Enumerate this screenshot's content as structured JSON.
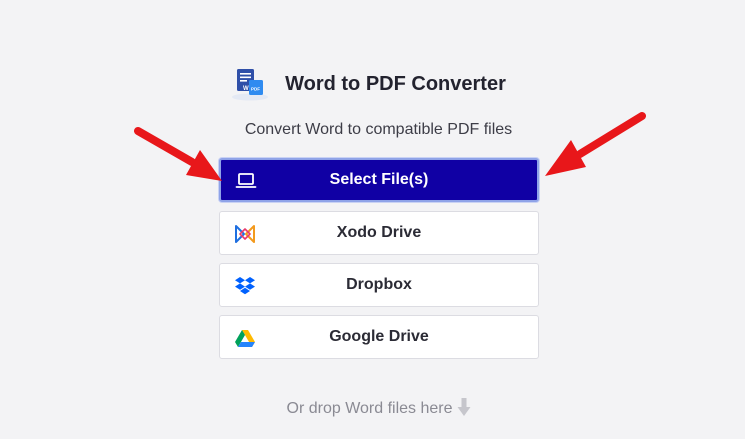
{
  "header": {
    "title": "Word to PDF Converter",
    "icon": "word-to-pdf-icon",
    "subtitle": "Convert Word to compatible PDF files"
  },
  "buttons": {
    "select_files": {
      "label": "Select File(s)",
      "icon": "laptop-icon"
    },
    "xodo_drive": {
      "label": "Xodo Drive",
      "icon": "xodo-logo-icon"
    },
    "dropbox": {
      "label": "Dropbox",
      "icon": "dropbox-logo-icon"
    },
    "google_drive": {
      "label": "Google Drive",
      "icon": "google-drive-logo-icon"
    }
  },
  "drop_hint": {
    "label": "Or drop Word files here",
    "icon": "arrow-down-icon"
  },
  "annotations": {
    "arrows": [
      "red-arrow-left",
      "red-arrow-right"
    ],
    "arrow_color": "#e8171a"
  },
  "colors": {
    "primary_button": "#1000a4",
    "page_background": "#f3f3f5",
    "title_text": "#23232f"
  }
}
